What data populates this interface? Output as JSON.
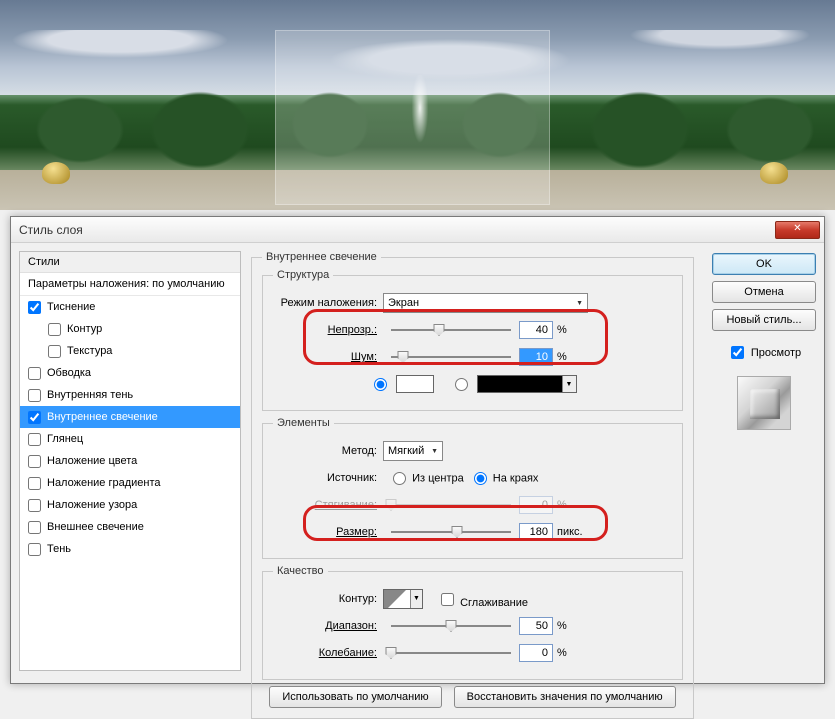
{
  "dialog": {
    "title": "Стиль слоя"
  },
  "left": {
    "styles_header": "Стили",
    "params_label": "Параметры наложения: по умолчанию",
    "items": [
      {
        "label": "Тиснение",
        "checked": true
      },
      {
        "label": "Контур",
        "checked": false,
        "indent": true
      },
      {
        "label": "Текстура",
        "checked": false,
        "indent": true
      },
      {
        "label": "Обводка",
        "checked": false
      },
      {
        "label": "Внутренняя тень",
        "checked": false
      },
      {
        "label": "Внутреннее свечение",
        "checked": true,
        "selected": true
      },
      {
        "label": "Глянец",
        "checked": false
      },
      {
        "label": "Наложение цвета",
        "checked": false
      },
      {
        "label": "Наложение градиента",
        "checked": false
      },
      {
        "label": "Наложение узора",
        "checked": false
      },
      {
        "label": "Внешнее свечение",
        "checked": false
      },
      {
        "label": "Тень",
        "checked": false
      }
    ]
  },
  "center": {
    "panel_title": "Внутреннее свечение",
    "structure": {
      "legend": "Структура",
      "blend_mode_label": "Режим наложения:",
      "blend_mode_value": "Экран",
      "opacity_label": "Непрозр.:",
      "opacity_value": "40",
      "opacity_unit": "%",
      "noise_label": "Шум:",
      "noise_value": "10",
      "noise_unit": "%",
      "color_hex": "#ffffff"
    },
    "elements": {
      "legend": "Элементы",
      "method_label": "Метод:",
      "method_value": "Мягкий",
      "source_label": "Источник:",
      "source_center": "Из центра",
      "source_edge": "На краях",
      "spread_label": "Стягивание:",
      "spread_value": "0",
      "spread_unit": "%",
      "size_label": "Размер:",
      "size_value": "180",
      "size_unit": "пикс."
    },
    "quality": {
      "legend": "Качество",
      "contour_label": "Контур:",
      "antialias_label": "Сглаживание",
      "range_label": "Диапазон:",
      "range_value": "50",
      "range_unit": "%",
      "jitter_label": "Колебание:",
      "jitter_value": "0",
      "jitter_unit": "%"
    },
    "buttons": {
      "use_default": "Использовать по умолчанию",
      "reset_default": "Восстановить значения по умолчанию"
    }
  },
  "right": {
    "ok": "OK",
    "cancel": "Отмена",
    "new_style": "Новый стиль...",
    "preview": "Просмотр"
  }
}
